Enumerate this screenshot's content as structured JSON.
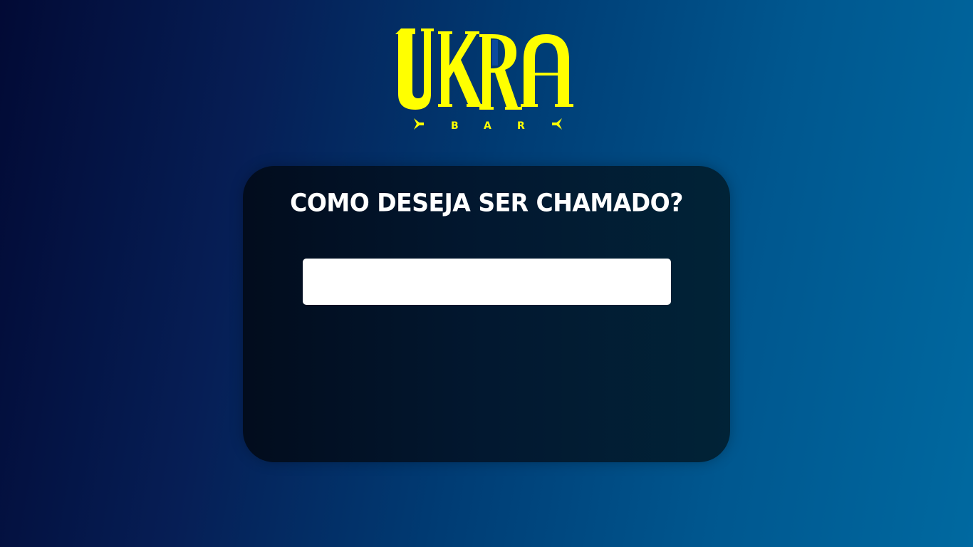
{
  "brand": {
    "logo_text": "UKRA",
    "logo_subtext": "BAR",
    "logo_color": "#ffff00",
    "logo_accent_color": "#0b4a9e"
  },
  "form": {
    "title": "COMO DESEJA SER CHAMADO?",
    "name_input": {
      "value": "",
      "placeholder": ""
    }
  },
  "colors": {
    "background_start": "#020a35",
    "background_end": "#0069a0",
    "card_background": "#021830",
    "title_color": "#ffffff",
    "input_background": "#ffffff"
  }
}
